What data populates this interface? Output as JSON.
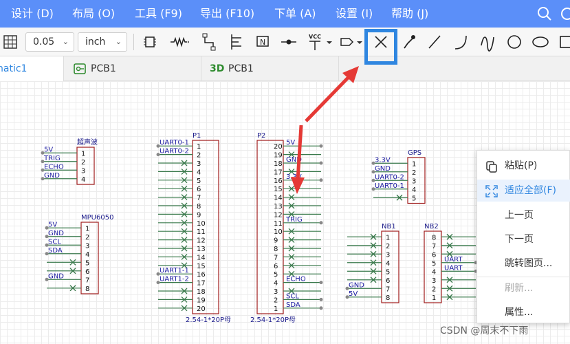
{
  "menu": {
    "design": "设计 (D)",
    "layout": "布局 (O)",
    "tools": "工具 (F9)",
    "export": "导出 (F10)",
    "order": "下单 (A)",
    "settings": "设置 (I)",
    "help": "帮助 (J)"
  },
  "toolbar": {
    "grid_value": "0.05",
    "unit": "inch",
    "vcc": "VCC"
  },
  "tabs": {
    "schematic": "natic1",
    "pcb": "PCB1",
    "pcb3d_prefix": "3D",
    "pcb3d": "PCB1"
  },
  "schematic": {
    "u_sonic": {
      "title": "超声波",
      "pins": [
        "1",
        "2",
        "3",
        "4"
      ],
      "nets": [
        "5V",
        "TRIG",
        "ECHO",
        "GND"
      ]
    },
    "mpu": {
      "title": "MPU6050",
      "pins": [
        "1",
        "2",
        "3",
        "4",
        "5",
        "6",
        "7",
        "8"
      ],
      "nets": [
        "5V",
        "GND",
        "SCL",
        "SDA",
        "",
        "",
        "GND",
        ""
      ]
    },
    "p1": {
      "title": "P1",
      "footer": "2.54-1*20P母",
      "pins": [
        "1",
        "2",
        "3",
        "4",
        "5",
        "6",
        "7",
        "8",
        "9",
        "10",
        "11",
        "12",
        "13",
        "14",
        "15",
        "16",
        "17",
        "18",
        "19",
        "20"
      ],
      "nets": [
        "UART0-1",
        "UART0-2",
        "",
        "",
        "",
        "",
        "",
        "",
        "",
        "",
        "",
        "",
        "",
        "",
        "",
        "UART1-1",
        "UART1-2",
        "",
        "",
        ""
      ]
    },
    "p2": {
      "title": "P2",
      "footer": "2.54-1*20P母",
      "pins": [
        "20",
        "19",
        "18",
        "17",
        "16",
        "15",
        "14",
        "13",
        "12",
        "11",
        "10",
        "9",
        "8",
        "7",
        "6",
        "5",
        "4",
        "3",
        "2",
        "1"
      ],
      "nets": [
        "5V",
        "",
        "GND",
        "",
        "3.3V",
        "",
        "",
        "",
        "",
        "TRIG",
        "",
        "",
        "",
        "",
        "",
        "",
        "ECHO",
        "",
        "SCL",
        "SDA"
      ]
    },
    "gps": {
      "title": "GPS",
      "pins": [
        "1",
        "2",
        "3",
        "4",
        "5"
      ],
      "nets": [
        "3.3V",
        "GND",
        "UART0-2",
        "UART0-1",
        ""
      ]
    },
    "nb1": {
      "title": "NB1",
      "pins": [
        "1",
        "2",
        "3",
        "4",
        "5",
        "6",
        "7",
        "8"
      ],
      "nets": [
        "",
        "",
        "",
        "",
        "",
        "",
        "GND",
        "5V"
      ]
    },
    "nb2": {
      "title": "NB2",
      "pins": [
        "8",
        "7",
        "6",
        "5",
        "4",
        "3",
        "2",
        "1"
      ],
      "nets": [
        "",
        "",
        "",
        "UART",
        "UART",
        "",
        "",
        ""
      ]
    }
  },
  "context_menu": {
    "paste": "粘贴(P)",
    "fit_all": "适应全部(F)",
    "prev_page": "上一页",
    "next_page": "下一页",
    "goto_page": "跳转图页...",
    "refresh": "刷新...",
    "properties": "属性..."
  },
  "watermark": "CSDN @周末不下雨",
  "colors": {
    "menubar": "#5b8ff9",
    "wire": "#3a7a4c",
    "net_label": "#1a1aa0",
    "component": "#a01c1c",
    "highlight": "#2f86e0",
    "arrow": "#e53935"
  }
}
